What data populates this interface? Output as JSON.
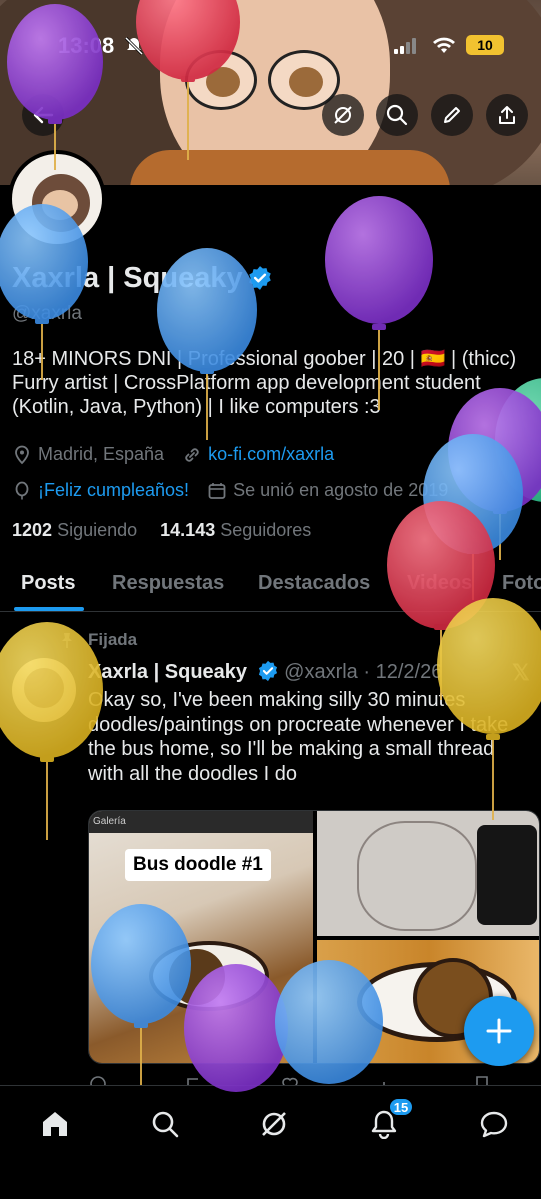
{
  "status_bar": {
    "time": "13:08",
    "battery": "10"
  },
  "profile": {
    "display_name": "Xaxrla | Squeaky",
    "handle": "@xaxrla",
    "bio": "18+ MINORS DNI | Professional goober | 20 | 🇪🇸 | (thicc) Furry artist | CrossPlatform app development student (Kotlin, Java, Python) | I like computers :3",
    "location": "Madrid, España",
    "link": "ko-fi.com/xaxrla",
    "birthday": "¡Feliz cumpleaños!",
    "joined": "Se unió en agosto de 2019",
    "following_count": "1202",
    "following_label": "Siguiendo",
    "followers_count": "14.143",
    "followers_label": "Seguidores"
  },
  "tabs": [
    {
      "label": "Posts",
      "active": true
    },
    {
      "label": "Respuestas"
    },
    {
      "label": "Destacados"
    },
    {
      "label": "Videos"
    },
    {
      "label": "Fotos"
    }
  ],
  "tweet": {
    "pinned_label": "Fijada",
    "author": "Xaxrla | Squeaky",
    "handle": "@xaxrla",
    "date": "· 12/2/26",
    "text": "Okay so, I've been making silly 30 minutes doodles/paintings on procreate whenever I take the bus home, so I'll be making a small thread with all the doodles I do",
    "media_caption": "Bus doodle #1",
    "media_toolbar": "Galería"
  },
  "bottom_nav": {
    "notifications_badge": "15"
  },
  "colors": {
    "accent": "#1d9bf0",
    "background": "#000000",
    "muted": "#71767b",
    "balloon_purple": "#8e3fd0",
    "balloon_blue": "#4a9be8",
    "balloon_red": "#e0384f",
    "balloon_yellow": "#e7c234",
    "balloon_teal": "#3fcf9e"
  }
}
